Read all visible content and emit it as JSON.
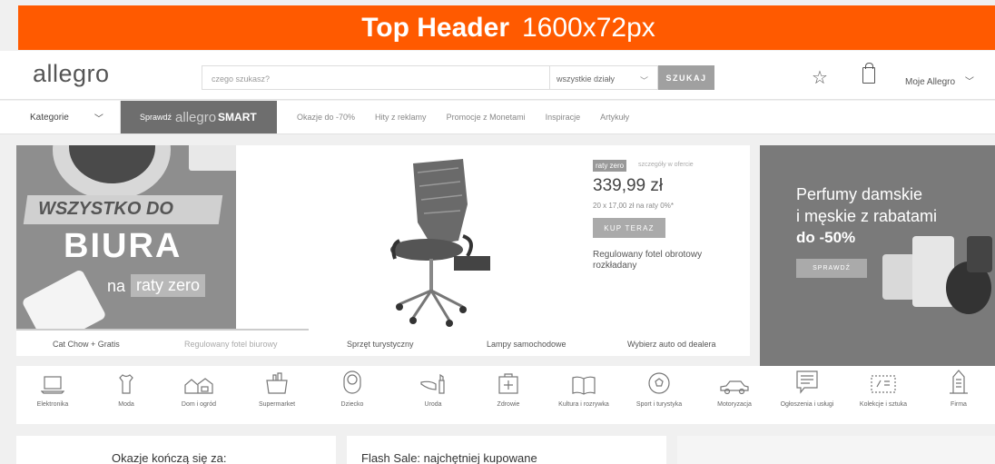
{
  "top_header": {
    "title": "Top Header",
    "size": "1600x72px"
  },
  "header": {
    "logo": "allegro",
    "search_placeholder": "czego szukasz?",
    "department": "wszystkie działy",
    "search_button": "SZUKAJ",
    "account": "Moje Allegro"
  },
  "nav": {
    "categories": "Kategorie",
    "smart_prefix": "Sprawdź",
    "smart_brand": "allegro",
    "smart_suffix": "SMART",
    "links": [
      "Okazje do -70%",
      "Hity z reklamy",
      "Promocje z Monetami",
      "Inspiracje",
      "Artykuły"
    ]
  },
  "banner_left": {
    "tagline": "WSZYSTKO DO",
    "headline": "BIURA",
    "na": "na",
    "raty": "raty zero"
  },
  "product": {
    "badge": "raty zero",
    "badge_note": "szczegóły w ofercie",
    "price": "339,99 zł",
    "installments": "20 x 17,00 zł na raty 0%*",
    "buy_button": "KUP TERAZ",
    "name": "Regulowany fotel obrotowy rozkładany"
  },
  "banner_right": {
    "line1": "Perfumy damskie",
    "line2": "i męskie z rabatami",
    "line3": "do -50%",
    "button": "SPRAWDŹ"
  },
  "captions": [
    "Cat Chow + Gratis",
    "Regulowany fotel biurowy",
    "Sprzęt turystyczny",
    "Lampy samochodowe",
    "Wybierz auto od dealera"
  ],
  "categories": [
    {
      "label": "Elektronika",
      "icon": "laptop-icon"
    },
    {
      "label": "Moda",
      "icon": "shirt-icon"
    },
    {
      "label": "Dom i ogród",
      "icon": "house-icon"
    },
    {
      "label": "Supermarket",
      "icon": "basket-icon"
    },
    {
      "label": "Dziecko",
      "icon": "baby-icon"
    },
    {
      "label": "Uroda",
      "icon": "lipstick-icon"
    },
    {
      "label": "Zdrowie",
      "icon": "first-aid-icon"
    },
    {
      "label": "Kultura i rozrywka",
      "icon": "book-icon"
    },
    {
      "label": "Sport i turystyka",
      "icon": "ball-icon"
    },
    {
      "label": "Motoryzacja",
      "icon": "car-icon"
    },
    {
      "label": "Ogłoszenia i usługi",
      "icon": "notice-icon"
    },
    {
      "label": "Kolekcje i sztuka",
      "icon": "stamp-icon"
    },
    {
      "label": "Firma",
      "icon": "building-icon"
    }
  ],
  "cards": {
    "deals": "Okazje kończą się za:",
    "flash": "Flash Sale: najchętniej kupowane"
  }
}
